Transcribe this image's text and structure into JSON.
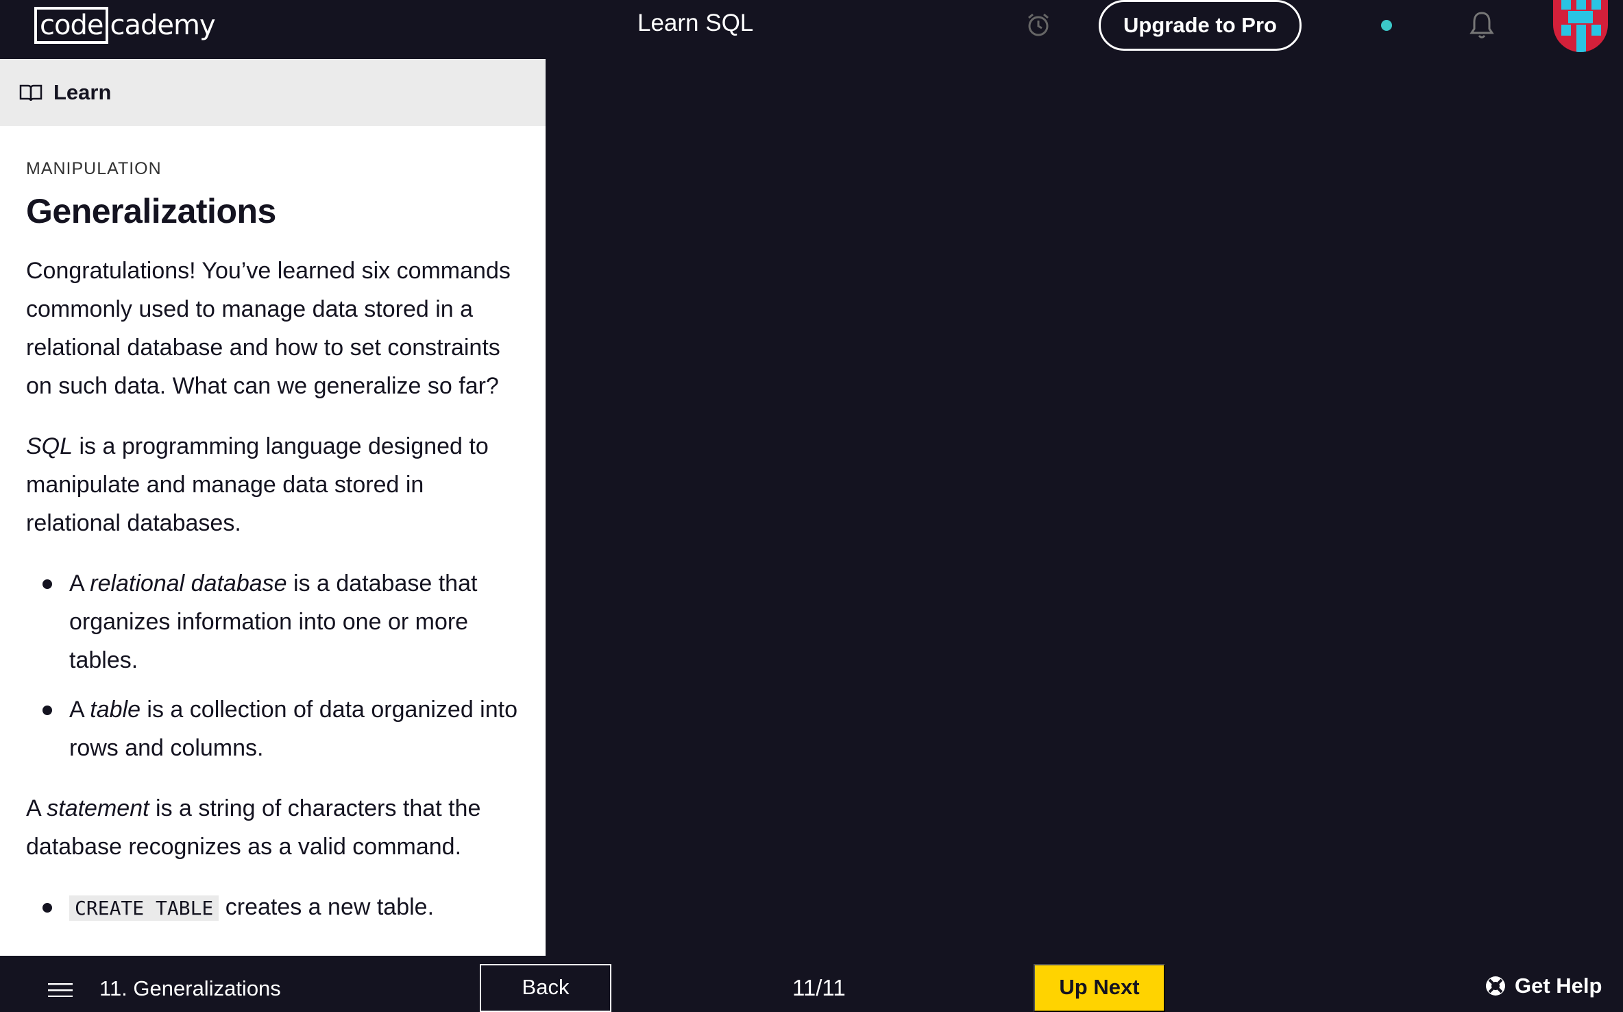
{
  "header": {
    "logo_left": "code",
    "logo_right": "cademy",
    "course_title": "Learn SQL",
    "upgrade_label": "Upgrade to Pro"
  },
  "panel": {
    "tab_label": "Learn",
    "section": "MANIPULATION",
    "title": "Generalizations",
    "p1": "Congratulations! You’ve learned six commands commonly used to manage data stored in a relational database and how to set constraints on such data. What can we generalize so far?",
    "p2_em": "SQL",
    "p2_rest": " is a programming language designed to manipulate and manage data stored in relational databases.",
    "b1_pre": "A ",
    "b1_em": "relational database",
    "b1_post": " is a database that organizes information into one or more tables.",
    "b2_pre": "A ",
    "b2_em": "table",
    "b2_post": " is a collection of data organized into rows and columns.",
    "p3_pre": "A ",
    "p3_em": "statement",
    "p3_post": " is a string of characters that the database recognizes as a valid command.",
    "b3_code": "CREATE TABLE",
    "b3_post": " creates a new table."
  },
  "footer": {
    "lesson_label": "11. Generalizations",
    "back_label": "Back",
    "progress": "11/11",
    "next_label": "Up Next",
    "help_label": "Get Help"
  },
  "colors": {
    "background": "#141320",
    "accent_yellow": "#ffd300",
    "status_dot": "#3cc8c8"
  }
}
